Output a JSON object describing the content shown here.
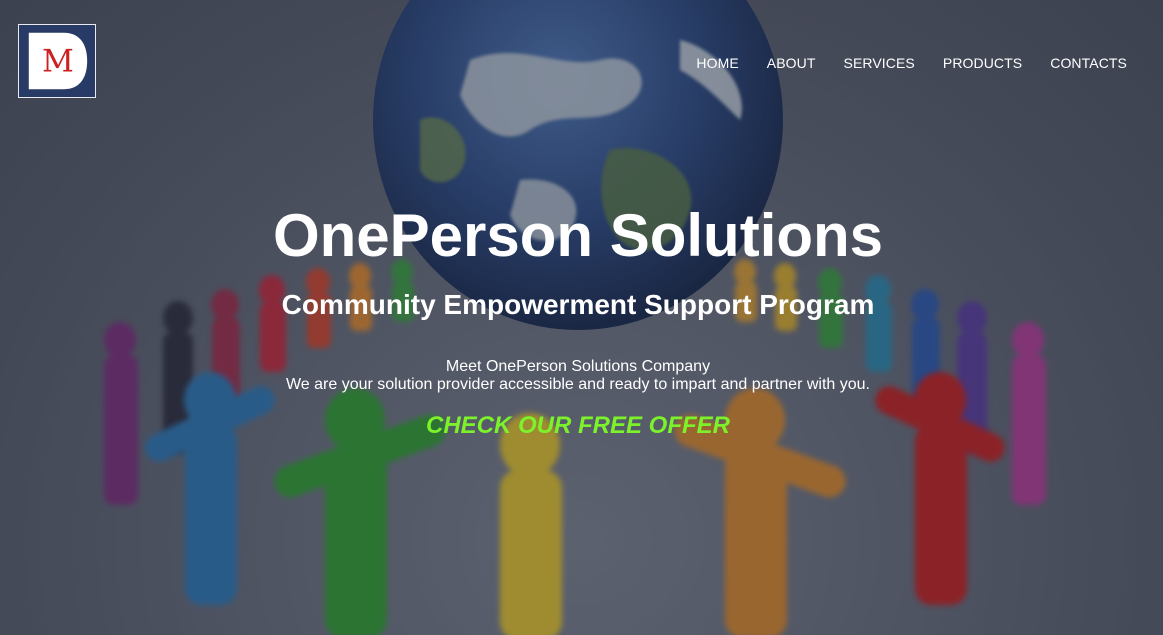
{
  "logo": {
    "letter": "M",
    "icon": "company-logo",
    "colors": {
      "background": "#283b66",
      "shield": "#ffffff",
      "letter": "#cc1f1f"
    }
  },
  "nav": {
    "items": [
      {
        "label": "HOME"
      },
      {
        "label": "ABOUT"
      },
      {
        "label": "SERVICES"
      },
      {
        "label": "PRODUCTS"
      },
      {
        "label": "CONTACTS"
      }
    ]
  },
  "hero": {
    "title": "OnePerson Solutions",
    "subtitle": "Community Empowerment Support Program",
    "description_line1": "Meet OnePerson Solutions Company",
    "description_line2": "We are your solution provider accessible and ready to impart and partner with you.",
    "cta_label": "CHECK OUR FREE OFFER",
    "background_image": "globe-with-people-circle",
    "colors": {
      "text": "#ffffff",
      "cta": "#7cf22a",
      "overlay": "#3a3f4f"
    }
  }
}
